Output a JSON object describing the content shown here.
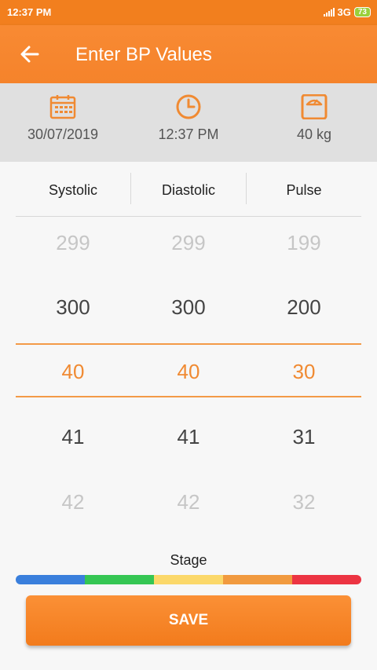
{
  "status_bar": {
    "time": "12:37 PM",
    "network": "3G",
    "battery": "73"
  },
  "header": {
    "title": "Enter BP Values"
  },
  "info": {
    "date": "30/07/2019",
    "time": "12:37 PM",
    "weight": "40 kg"
  },
  "columns": [
    "Systolic",
    "Diastolic",
    "Pulse"
  ],
  "pickers": {
    "systolic": [
      "299",
      "300",
      "40",
      "41",
      "42"
    ],
    "diastolic": [
      "299",
      "300",
      "40",
      "41",
      "42"
    ],
    "pulse": [
      "199",
      "200",
      "30",
      "31",
      "32"
    ]
  },
  "selected": {
    "systolic": "40",
    "diastolic": "40",
    "pulse": "30"
  },
  "stage": {
    "label": "Stage",
    "colors": [
      "#3a7fdc",
      "#35c653",
      "#fbd86a",
      "#f19a3f",
      "#ec3442"
    ]
  },
  "save_label": "SAVE",
  "accent_color": "#f5832b"
}
